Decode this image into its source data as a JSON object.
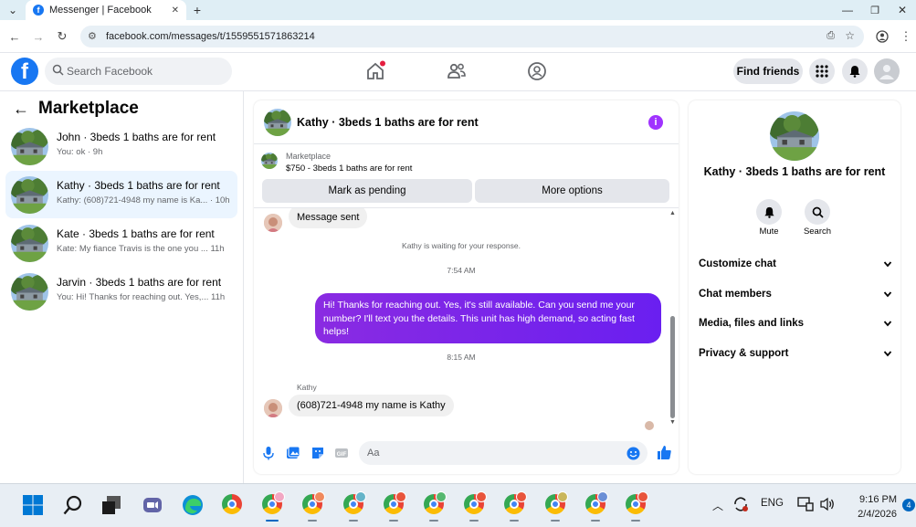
{
  "browser": {
    "tab_title": "Messenger | Facebook",
    "url": "facebook.com/messages/t/1559551571863214",
    "new_tab_label": "+",
    "tab_close_label": "✕"
  },
  "fb_header": {
    "logo": "f",
    "search_placeholder": "Search Facebook",
    "find_friends_label": "Find friends"
  },
  "marketplace": {
    "title": "Marketplace",
    "conversations": [
      {
        "name": "John · 3beds 1 baths are for rent",
        "preview": "You: ok · 9h",
        "active": false
      },
      {
        "name": "Kathy · 3beds 1 baths are for rent",
        "preview": "Kathy: (608)721-4948 my name is Ka... · 10h",
        "active": true
      },
      {
        "name": "Kate · 3beds 1 baths are for rent",
        "preview": "Kate: My fiance Travis is the one you ... 11h",
        "active": false
      },
      {
        "name": "Jarvin · 3beds 1 baths are for rent",
        "preview": "You: Hi! Thanks for reaching out. Yes,... 11h",
        "active": false
      }
    ]
  },
  "chat": {
    "title": "Kathy · 3beds 1 baths are for rent",
    "listing_source": "Marketplace",
    "listing_price": "$750 - 3beds 1 baths are for rent",
    "mark_pending_label": "Mark as pending",
    "more_options_label": "More options",
    "messages": {
      "sent_confirmation": "Message sent",
      "waiting_notice": "Kathy is waiting for your response.",
      "time_1": "7:54 AM",
      "outgoing": "Hi! Thanks for reaching out. Yes, it's still available. Can you send me your number? I'll text you the details. This unit has high demand, so acting fast helps!",
      "time_2": "8:15 AM",
      "sender_name": "Kathy",
      "incoming": "(608)721-4948 my name is Kathy"
    },
    "composer_placeholder": "Aa"
  },
  "details": {
    "name": "Kathy · 3beds 1 baths are for rent",
    "mute_label": "Mute",
    "search_label": "Search",
    "sections": [
      "Customize chat",
      "Chat members",
      "Media, files and links",
      "Privacy & support"
    ]
  },
  "taskbar": {
    "language": "ENG",
    "time": "9:16 PM",
    "date": "2/4/2026",
    "notification_count": "4"
  },
  "colors": {
    "fb_blue": "#1877f2",
    "messenger_purple": "#7b1fe6",
    "active_conversation": "#ebf5ff"
  }
}
